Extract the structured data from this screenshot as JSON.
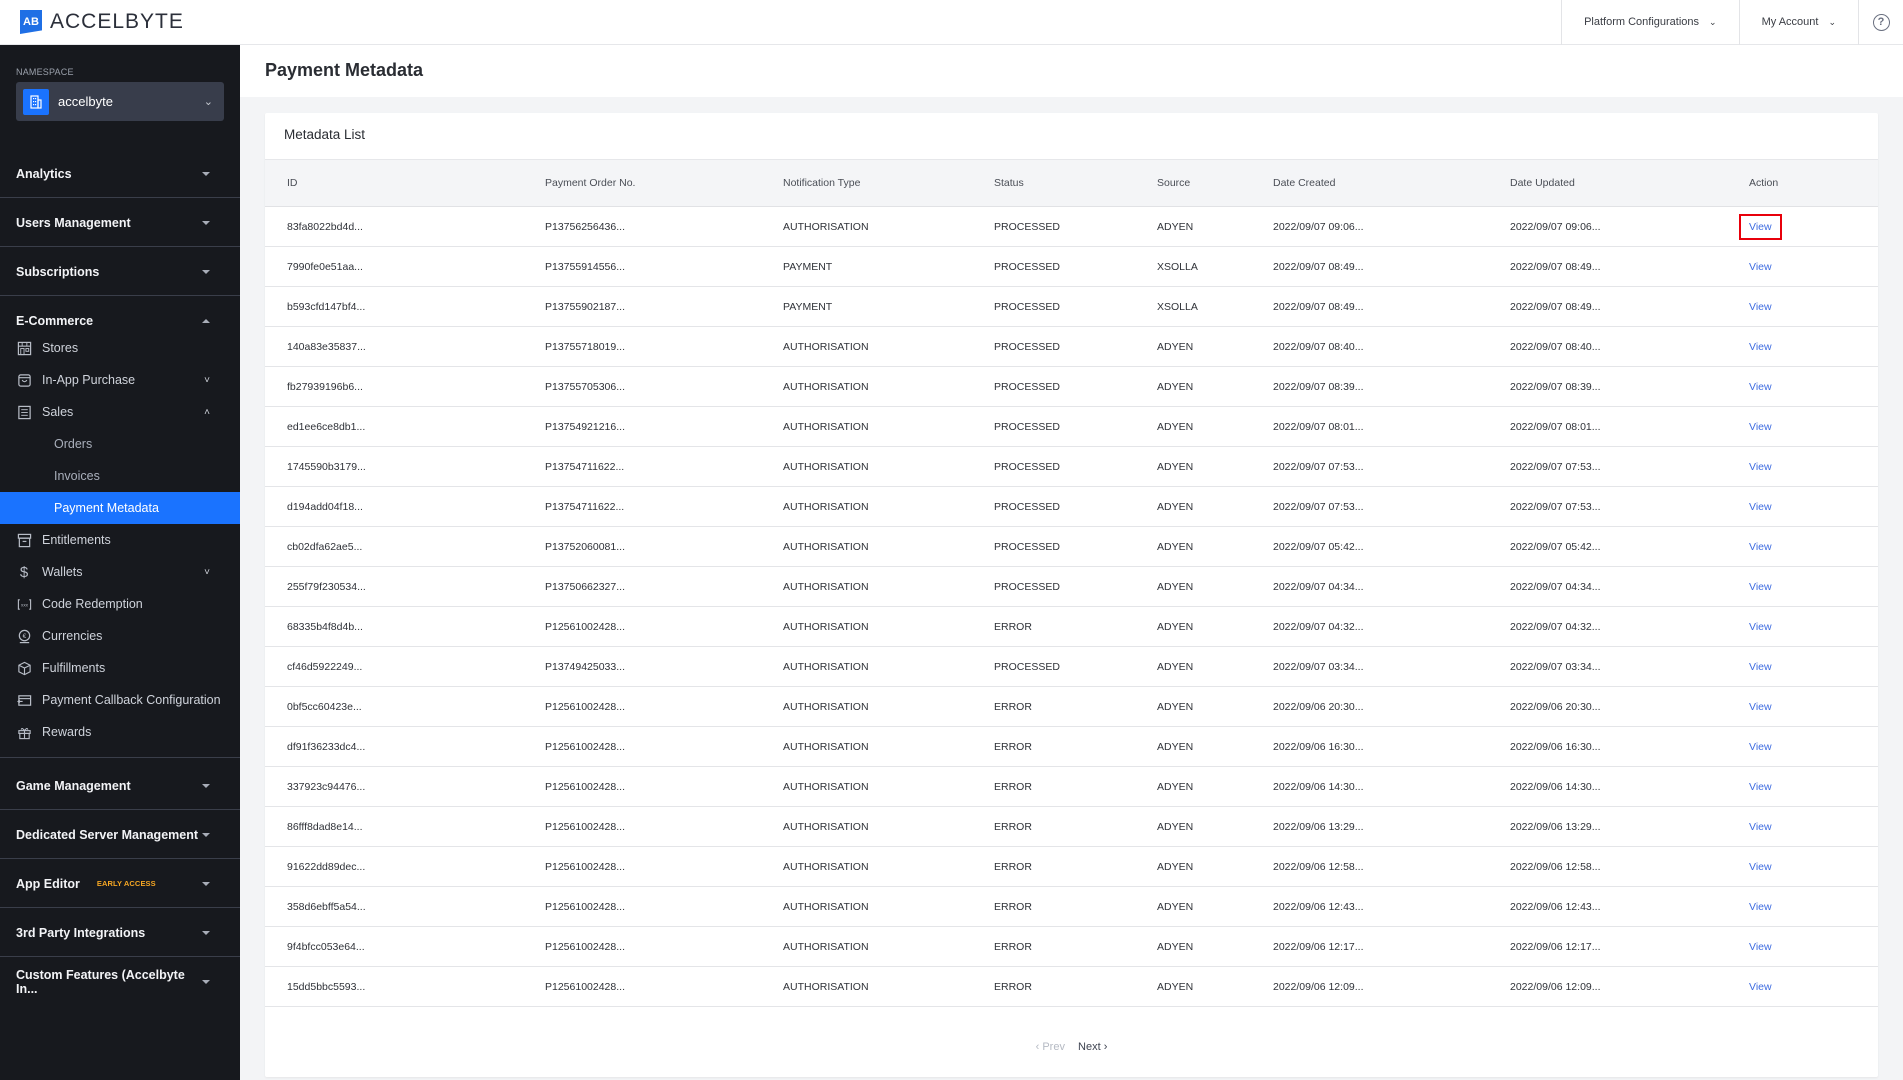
{
  "header": {
    "logo_text": "ACCELBYTE",
    "logo_mark": "AB",
    "menus": [
      {
        "label": "Platform Configurations",
        "icon": "chevron-down-icon"
      },
      {
        "label": "My Account",
        "icon": "chevron-down-icon"
      }
    ],
    "help_icon": "?"
  },
  "sidebar": {
    "namespace_label": "NAMESPACE",
    "namespace_value": "accelbyte",
    "sections_top": [
      {
        "label": "Analytics"
      },
      {
        "label": "Users Management"
      },
      {
        "label": "Subscriptions"
      }
    ],
    "ecommerce": {
      "label": "E-Commerce",
      "items": [
        {
          "label": "Stores",
          "icon": "store-icon"
        },
        {
          "label": "In-App Purchase",
          "icon": "bag-icon",
          "chevron": "˅"
        },
        {
          "label": "Sales",
          "icon": "receipt-icon",
          "chevron": "˄"
        },
        {
          "label": "Entitlements",
          "icon": "archive-icon"
        },
        {
          "label": "Wallets",
          "icon": "dollar-icon",
          "chevron": "˅"
        },
        {
          "label": "Code Redemption",
          "icon": "code-icon"
        },
        {
          "label": "Currencies",
          "icon": "currency-icon"
        },
        {
          "label": "Fulfillments",
          "icon": "box-icon"
        },
        {
          "label": "Payment Callback Configuration",
          "icon": "callback-icon"
        },
        {
          "label": "Rewards",
          "icon": "gift-icon"
        }
      ],
      "sales_sub": [
        {
          "label": "Orders"
        },
        {
          "label": "Invoices"
        },
        {
          "label": "Payment Metadata",
          "active": true
        }
      ]
    },
    "sections_bottom": [
      {
        "label": "Game Management"
      },
      {
        "label": "Dedicated Server Management"
      },
      {
        "label": "App Editor",
        "badge": "EARLY ACCESS"
      },
      {
        "label": "3rd Party Integrations"
      },
      {
        "label": "Custom Features (Accelbyte In..."
      }
    ]
  },
  "page": {
    "title": "Payment Metadata",
    "card_title": "Metadata List"
  },
  "table": {
    "columns": [
      "ID",
      "Payment Order No.",
      "Notification Type",
      "Status",
      "Source",
      "Date Created",
      "Date Updated",
      "Action"
    ],
    "rows": [
      [
        "83fa8022bd4d...",
        "P13756256436...",
        "AUTHORISATION",
        "PROCESSED",
        "ADYEN",
        "2022/09/07 09:06...",
        "2022/09/07 09:06...",
        "View"
      ],
      [
        "7990fe0e51aa...",
        "P13755914556...",
        "PAYMENT",
        "PROCESSED",
        "XSOLLA",
        "2022/09/07 08:49...",
        "2022/09/07 08:49...",
        "View"
      ],
      [
        "b593cfd147bf4...",
        "P13755902187...",
        "PAYMENT",
        "PROCESSED",
        "XSOLLA",
        "2022/09/07 08:49...",
        "2022/09/07 08:49...",
        "View"
      ],
      [
        "140a83e35837...",
        "P13755718019...",
        "AUTHORISATION",
        "PROCESSED",
        "ADYEN",
        "2022/09/07 08:40...",
        "2022/09/07 08:40...",
        "View"
      ],
      [
        "fb27939196b6...",
        "P13755705306...",
        "AUTHORISATION",
        "PROCESSED",
        "ADYEN",
        "2022/09/07 08:39...",
        "2022/09/07 08:39...",
        "View"
      ],
      [
        "ed1ee6ce8db1...",
        "P13754921216...",
        "AUTHORISATION",
        "PROCESSED",
        "ADYEN",
        "2022/09/07 08:01...",
        "2022/09/07 08:01...",
        "View"
      ],
      [
        "1745590b3179...",
        "P13754711622...",
        "AUTHORISATION",
        "PROCESSED",
        "ADYEN",
        "2022/09/07 07:53...",
        "2022/09/07 07:53...",
        "View"
      ],
      [
        "d194add04f18...",
        "P13754711622...",
        "AUTHORISATION",
        "PROCESSED",
        "ADYEN",
        "2022/09/07 07:53...",
        "2022/09/07 07:53...",
        "View"
      ],
      [
        "cb02dfa62ae5...",
        "P13752060081...",
        "AUTHORISATION",
        "PROCESSED",
        "ADYEN",
        "2022/09/07 05:42...",
        "2022/09/07 05:42...",
        "View"
      ],
      [
        "255f79f230534...",
        "P13750662327...",
        "AUTHORISATION",
        "PROCESSED",
        "ADYEN",
        "2022/09/07 04:34...",
        "2022/09/07 04:34...",
        "View"
      ],
      [
        "68335b4f8d4b...",
        "P12561002428...",
        "AUTHORISATION",
        "ERROR",
        "ADYEN",
        "2022/09/07 04:32...",
        "2022/09/07 04:32...",
        "View"
      ],
      [
        "cf46d5922249...",
        "P13749425033...",
        "AUTHORISATION",
        "PROCESSED",
        "ADYEN",
        "2022/09/07 03:34...",
        "2022/09/07 03:34...",
        "View"
      ],
      [
        "0bf5cc60423e...",
        "P12561002428...",
        "AUTHORISATION",
        "ERROR",
        "ADYEN",
        "2022/09/06 20:30...",
        "2022/09/06 20:30...",
        "View"
      ],
      [
        "df91f36233dc4...",
        "P12561002428...",
        "AUTHORISATION",
        "ERROR",
        "ADYEN",
        "2022/09/06 16:30...",
        "2022/09/06 16:30...",
        "View"
      ],
      [
        "337923c94476...",
        "P12561002428...",
        "AUTHORISATION",
        "ERROR",
        "ADYEN",
        "2022/09/06 14:30...",
        "2022/09/06 14:30...",
        "View"
      ],
      [
        "86fff8dad8e14...",
        "P12561002428...",
        "AUTHORISATION",
        "ERROR",
        "ADYEN",
        "2022/09/06 13:29...",
        "2022/09/06 13:29...",
        "View"
      ],
      [
        "91622dd89dec...",
        "P12561002428...",
        "AUTHORISATION",
        "ERROR",
        "ADYEN",
        "2022/09/06 12:58...",
        "2022/09/06 12:58...",
        "View"
      ],
      [
        "358d6ebff5a54...",
        "P12561002428...",
        "AUTHORISATION",
        "ERROR",
        "ADYEN",
        "2022/09/06 12:43...",
        "2022/09/06 12:43...",
        "View"
      ],
      [
        "9f4bfcc053e64...",
        "P12561002428...",
        "AUTHORISATION",
        "ERROR",
        "ADYEN",
        "2022/09/06 12:17...",
        "2022/09/06 12:17...",
        "View"
      ],
      [
        "15dd5bbc5593...",
        "P12561002428...",
        "AUTHORISATION",
        "ERROR",
        "ADYEN",
        "2022/09/06 12:09...",
        "2022/09/06 12:09...",
        "View"
      ]
    ],
    "highlighted_row": 0
  },
  "pagination": {
    "prev_label": "‹ Prev",
    "next_label": "Next ›"
  },
  "colors": {
    "accent": "#1a73ff",
    "sidebar_bg": "#17191e",
    "link": "#3d6be0",
    "highlight_box": "#e8000b",
    "early_access": "#f5a623"
  }
}
